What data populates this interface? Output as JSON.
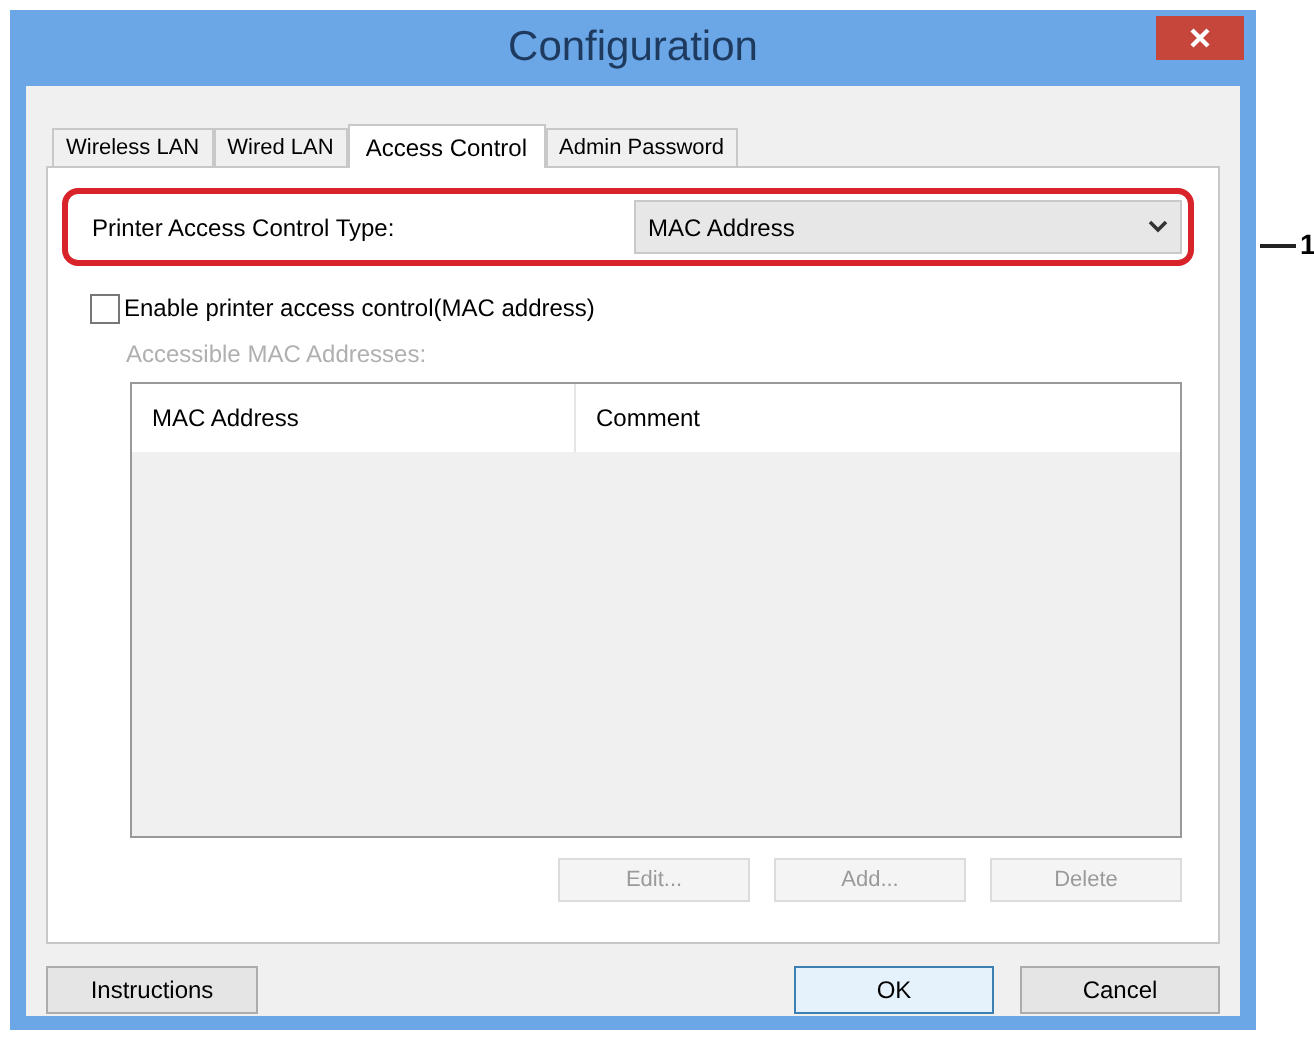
{
  "window": {
    "title": "Configuration"
  },
  "tabs": [
    {
      "label": "Wireless LAN",
      "selected": false
    },
    {
      "label": "Wired LAN",
      "selected": false
    },
    {
      "label": "Access Control",
      "selected": true
    },
    {
      "label": "Admin Password",
      "selected": false
    }
  ],
  "access_control_type": {
    "label": "Printer Access Control Type:",
    "value": "MAC Address"
  },
  "callout": "1",
  "enable_checkbox": {
    "label": "Enable printer access control(MAC address)",
    "checked": false
  },
  "list": {
    "label": "Accessible MAC Addresses:",
    "disabled": true,
    "columns": [
      "MAC Address",
      "Comment"
    ]
  },
  "list_buttons": [
    {
      "label": "Edit...",
      "disabled": true
    },
    {
      "label": "Add...",
      "disabled": true
    },
    {
      "label": "Delete",
      "disabled": true
    }
  ],
  "footer_buttons": [
    {
      "label": "Instructions",
      "default": false
    },
    {
      "label": "OK",
      "default": true
    },
    {
      "label": "Cancel",
      "default": false
    }
  ]
}
